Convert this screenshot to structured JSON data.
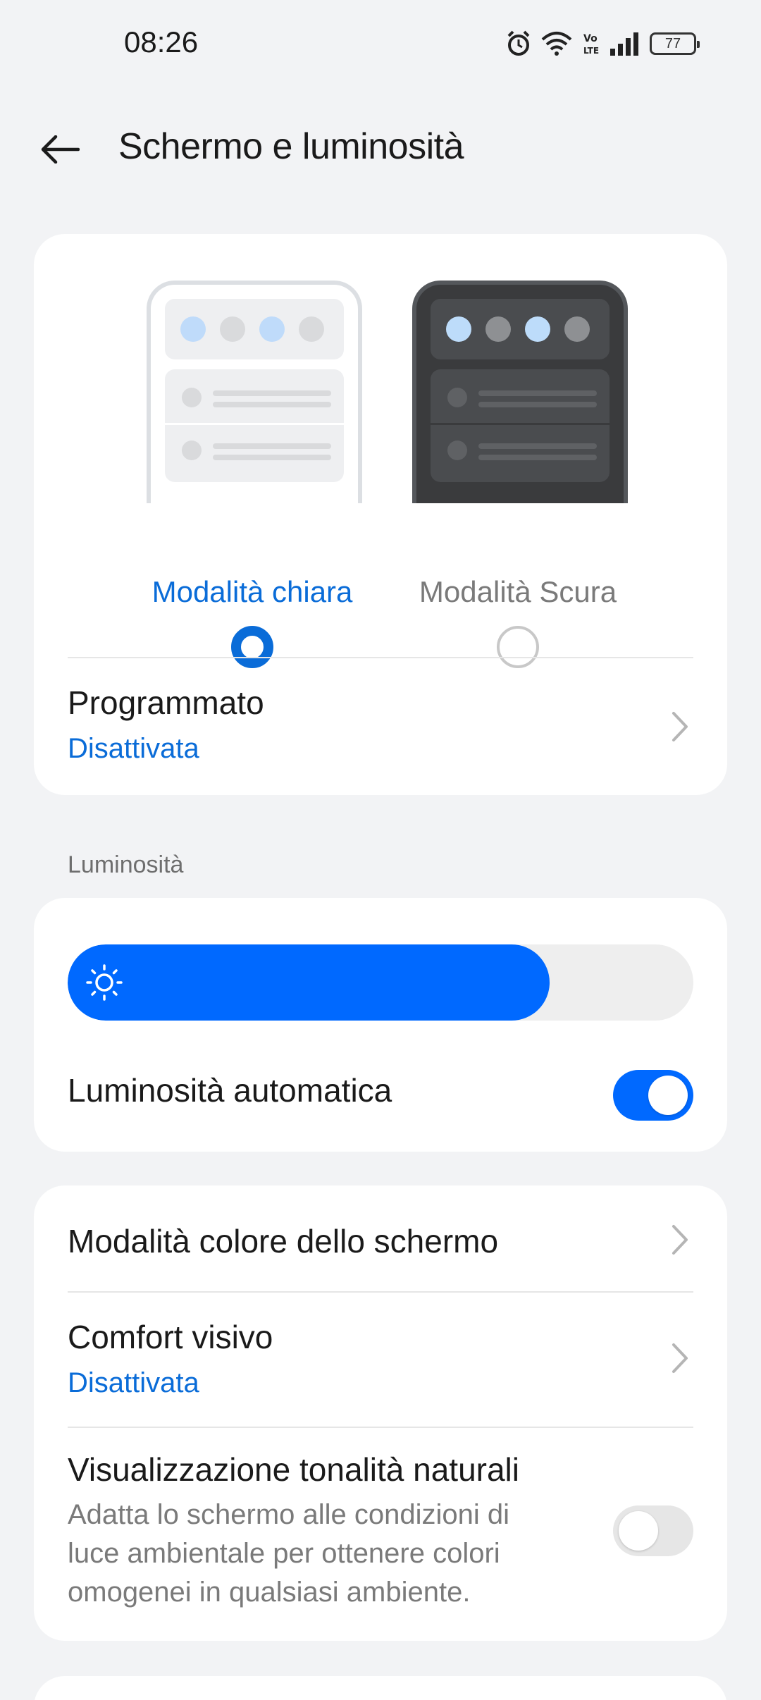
{
  "status_bar": {
    "time": "08:26",
    "battery": "77",
    "icons": [
      "alarm-icon",
      "wifi-icon",
      "volte-icon",
      "signal-icon",
      "battery-icon"
    ]
  },
  "header": {
    "title": "Schermo e luminosità",
    "back_icon": "arrow-left-icon"
  },
  "theme": {
    "light_label": "Modalità chiara",
    "dark_label": "Modalità Scura",
    "selected": "light",
    "schedule": {
      "title": "Programmato",
      "value": "Disattivata"
    }
  },
  "brightness": {
    "section_label": "Luminosità",
    "level_percent": 77,
    "auto_label": "Luminosità automatica",
    "auto_enabled": true
  },
  "display": {
    "color_mode_label": "Modalità colore dello schermo",
    "eye_comfort": {
      "title": "Comfort visivo",
      "value": "Disattivata"
    },
    "natural_tone": {
      "title": "Visualizzazione tonalità naturali",
      "description": "Adatta lo schermo alle condizioni di luce ambientale per ottenere colori omogenei in qualsiasi ambiente.",
      "enabled": false
    }
  },
  "colors": {
    "accent": "#0069FF",
    "accent_text": "#0A6CD8",
    "background": "#F2F3F5"
  }
}
